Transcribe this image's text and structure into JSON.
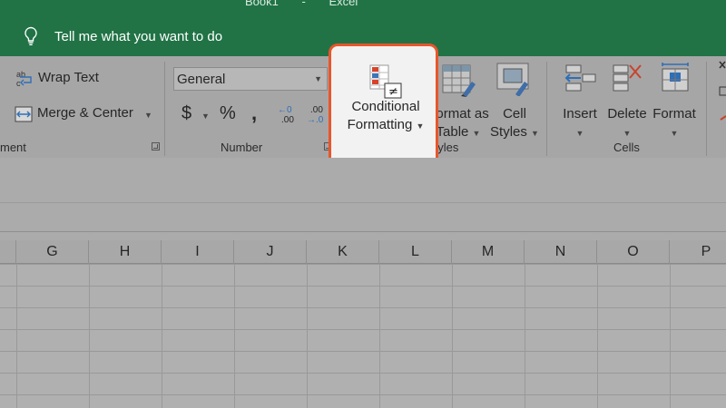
{
  "window": {
    "title_left": "Book1",
    "title_right": "Excel"
  },
  "tell_me": {
    "placeholder": "Tell me what you want to do",
    "icon": "lightbulb-icon"
  },
  "ribbon": {
    "alignment": {
      "wrap_text": "Wrap Text",
      "merge_center": "Merge & Center",
      "group_label": "ment"
    },
    "number": {
      "format_value": "General",
      "currency": "$",
      "percent": "%",
      "comma": ",",
      "inc_decimal_top": "←0",
      "inc_decimal_bottom": ".00",
      "dec_decimal_top": ".00",
      "dec_decimal_bottom": "→.0",
      "group_label": "Number"
    },
    "styles": {
      "conditional_formatting_line1": "Conditional",
      "conditional_formatting_line2": "Formatting",
      "format_as_table_line1": "Format as",
      "format_as_table_line2": "Table",
      "cell_styles_line1": "Cell",
      "cell_styles_line2": "Styles",
      "group_label": "Styles"
    },
    "cells": {
      "insert": "Insert",
      "delete": "Delete",
      "format": "Format",
      "group_label": "Cells"
    },
    "highlight_color": "#e8562c",
    "accent_color": "#217346"
  },
  "grid": {
    "columns": [
      "G",
      "H",
      "I",
      "J",
      "K",
      "L",
      "M",
      "N",
      "O",
      "P"
    ]
  }
}
